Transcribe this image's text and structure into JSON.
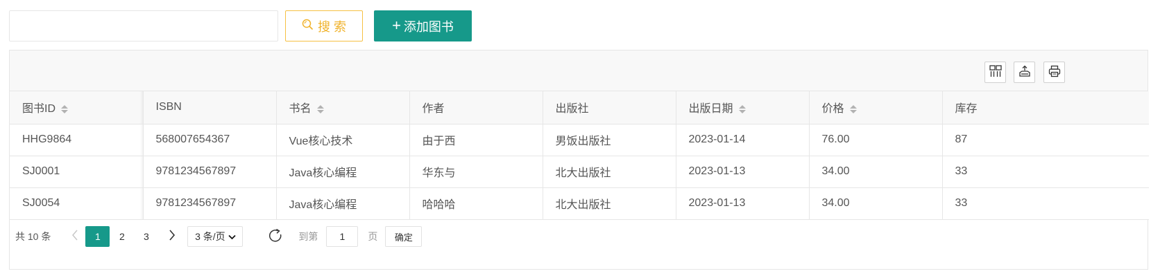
{
  "search": {
    "value": "",
    "placeholder": ""
  },
  "buttons": {
    "search_label": "搜 索",
    "add_label": "添加图书"
  },
  "colors": {
    "primary": "#16998a",
    "warn": "#f0b22b"
  },
  "toolbar_icons": [
    "columns-icon",
    "export-icon",
    "print-icon"
  ],
  "table": {
    "headers": [
      {
        "label": "图书ID",
        "sortable": true
      },
      {
        "label": "ISBN",
        "sortable": false
      },
      {
        "label": "书名",
        "sortable": true
      },
      {
        "label": "作者",
        "sortable": false
      },
      {
        "label": "出版社",
        "sortable": false
      },
      {
        "label": "出版日期",
        "sortable": true
      },
      {
        "label": "价格",
        "sortable": true
      },
      {
        "label": "库存",
        "sortable": false
      }
    ],
    "rows": [
      [
        "HHG9864",
        "568007654367",
        "Vue核心技术",
        "由于西",
        "男饭出版社",
        "2023-01-14",
        "76.00",
        "87"
      ],
      [
        "SJ0001",
        "9781234567897",
        "Java核心编程",
        "华东与",
        "北大出版社",
        "2023-01-13",
        "34.00",
        "33"
      ],
      [
        "SJ0054",
        "9781234567897",
        "Java核心编程",
        "哈哈哈",
        "北大出版社",
        "2023-01-13",
        "34.00",
        "33"
      ]
    ]
  },
  "pagination": {
    "total_text": "共 10 条",
    "pages": [
      "1",
      "2",
      "3"
    ],
    "current": "1",
    "limit_text": "3 条/页",
    "goto_label": "到第",
    "jump_value": "1",
    "page_unit": "页",
    "confirm_label": "确定"
  }
}
